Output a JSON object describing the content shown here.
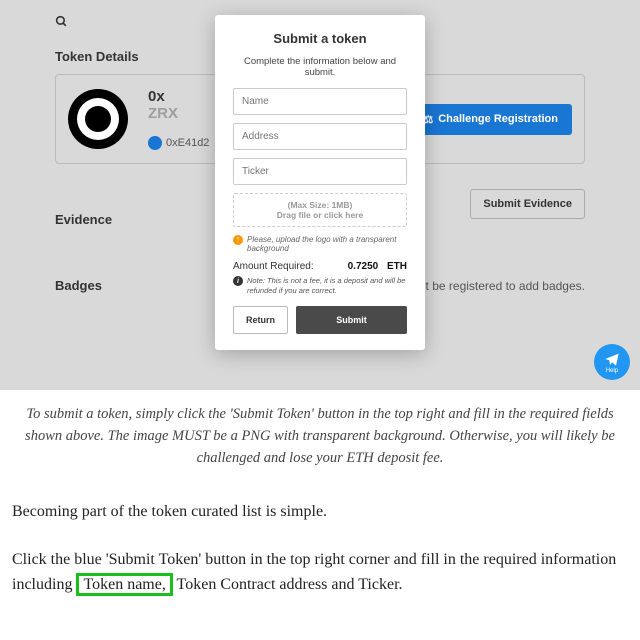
{
  "bg": {
    "section_token_details": "Token Details",
    "section_evidence": "Evidence",
    "section_badges": "Badges",
    "token_name": "0x",
    "token_symbol": "ZRX",
    "token_address": "0xE41d2",
    "challenge_label": "Challenge Registration",
    "submit_evidence_label": "Submit Evidence",
    "badge_notice": "must be registered to add badges.",
    "help_label": "Help"
  },
  "modal": {
    "title": "Submit a token",
    "subtitle": "Complete the information below and submit.",
    "name_placeholder": "Name",
    "address_placeholder": "Address",
    "ticker_placeholder": "Ticker",
    "drop_line1": "(Max Size: 1MB)",
    "drop_line2": "Drag file or click here",
    "warn_text": "Please, upload the logo with a transparent background",
    "amount_label": "Amount Required:",
    "amount_value": "0.7250",
    "amount_currency": "ETH",
    "note_text": "Note: This is not a fee, it is a deposit and will be refunded if you are correct.",
    "return_label": "Return",
    "submit_label": "Submit"
  },
  "caption": "To submit a token, simply click the 'Submit Token' button in the top right and fill in the required fields shown above. The image MUST be a PNG with transparent background. Otherwise, you will likely be challenged and lose your ETH deposit fee.",
  "article": {
    "p1": "Becoming part of the token curated list is simple.",
    "p2_a": "Click the blue 'Submit Token' button in the top right corner and fill in the required information including ",
    "p2_highlight": "Token name,",
    "p2_b": " Token Contract address and Ticker."
  }
}
